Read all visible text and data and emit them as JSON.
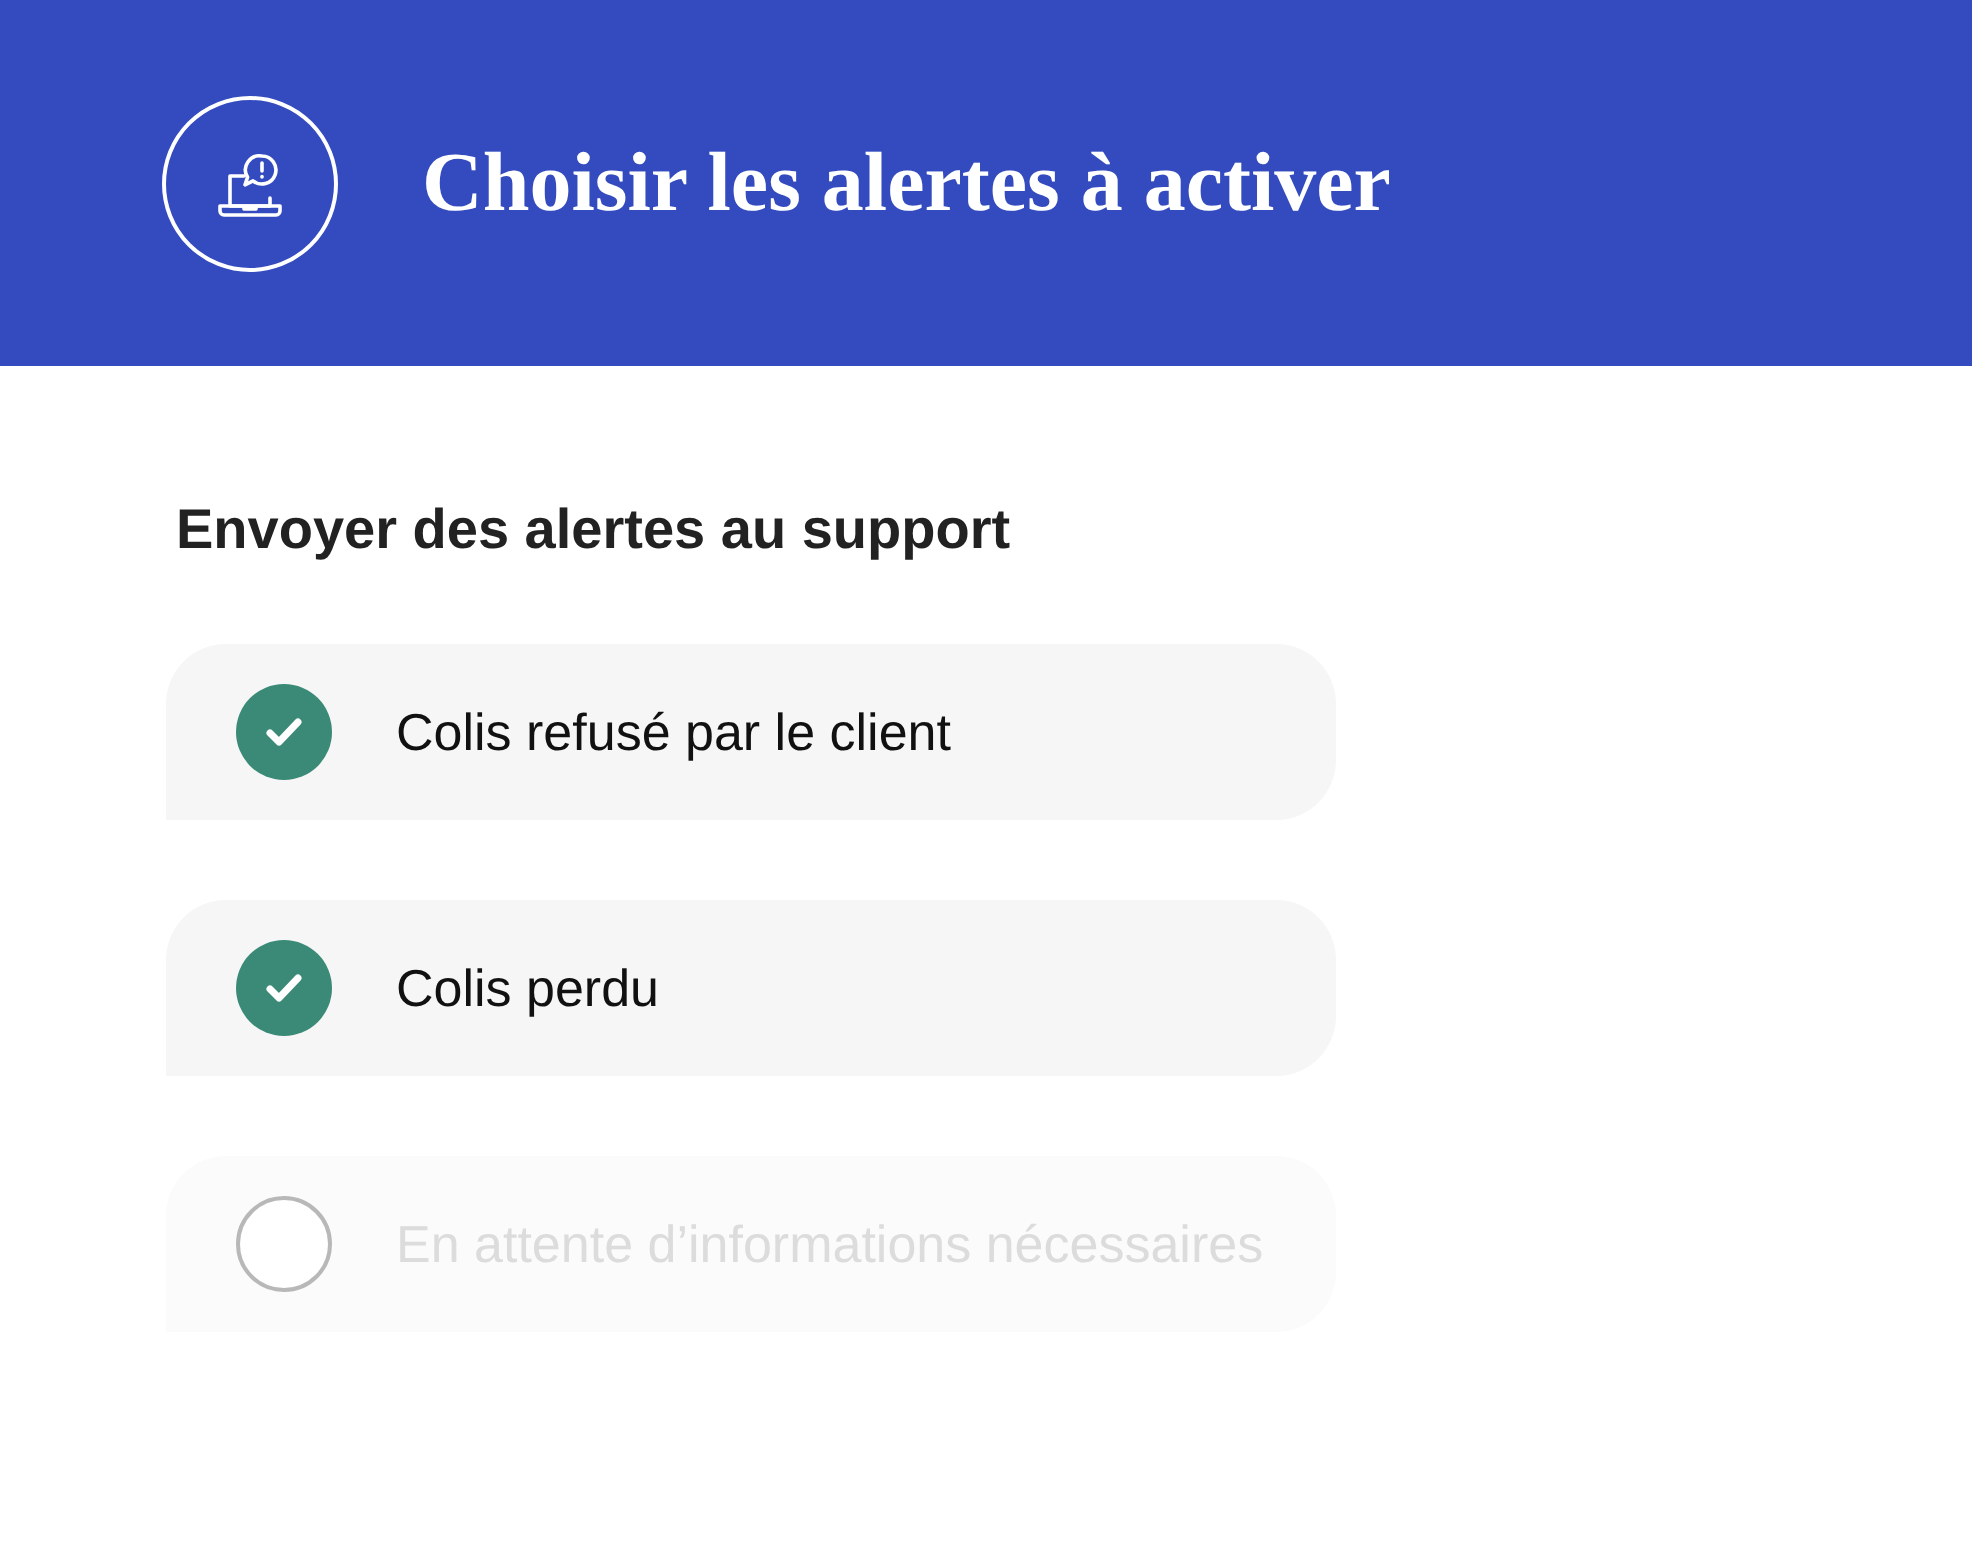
{
  "header": {
    "title": "Choisir les alertes à activer"
  },
  "section": {
    "title": "Envoyer des alertes au support"
  },
  "alerts": [
    {
      "label": "Colis refusé par le client",
      "checked": true,
      "disabled": false
    },
    {
      "label": "Colis perdu",
      "checked": true,
      "disabled": false
    },
    {
      "label": "En attente d’informations nécessaires",
      "checked": false,
      "disabled": true
    }
  ]
}
